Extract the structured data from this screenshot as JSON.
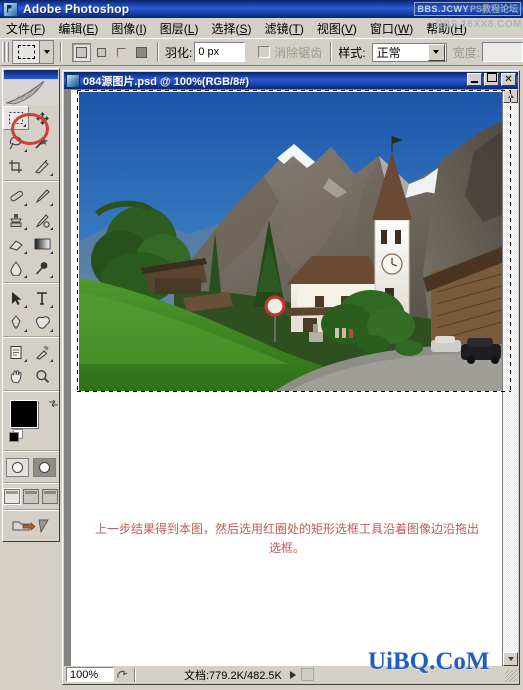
{
  "app": {
    "title": "Adobe Photoshop",
    "logo_icon": "photoshop-logo-icon",
    "watermark_top": "BBS.JCWY",
    "watermark_top2": "PS教程论坛",
    "watermark_menu": "BBS.16XX8.COM"
  },
  "menubar": {
    "items": [
      {
        "label": "文件",
        "mnemonic": "F"
      },
      {
        "label": "编辑",
        "mnemonic": "E"
      },
      {
        "label": "图像",
        "mnemonic": "I"
      },
      {
        "label": "图层",
        "mnemonic": "L"
      },
      {
        "label": "选择",
        "mnemonic": "S"
      },
      {
        "label": "滤镜",
        "mnemonic": "T"
      },
      {
        "label": "视图",
        "mnemonic": "V"
      },
      {
        "label": "窗口",
        "mnemonic": "W"
      },
      {
        "label": "帮助",
        "mnemonic": "H"
      }
    ]
  },
  "options_bar": {
    "tool_icon": "rectangular-marquee-icon",
    "tool_dropdown_icon": "chevron-down-icon",
    "selection_modes": [
      {
        "name": "new-selection",
        "active": true
      },
      {
        "name": "add-to-selection",
        "active": false
      },
      {
        "name": "subtract-from-selection",
        "active": false
      },
      {
        "name": "intersect-with-selection",
        "active": false
      }
    ],
    "feather_label": "羽化:",
    "feather_value": "0 px",
    "antialias_label": "消除锯齿",
    "antialias_checked": false,
    "style_label": "样式:",
    "style_value": "正常",
    "width_label": "宽度:",
    "width_value": ""
  },
  "toolbox": {
    "tools": [
      {
        "name": "rectangular-marquee-tool",
        "icon": "marquee-icon",
        "selected": true,
        "highlighted": true
      },
      {
        "name": "move-tool",
        "icon": "move-arrow-icon",
        "selected": false
      },
      {
        "name": "lasso-tool",
        "icon": "lasso-icon",
        "selected": false
      },
      {
        "name": "magic-wand-tool",
        "icon": "magic-wand-icon",
        "selected": false
      },
      {
        "name": "crop-tool",
        "icon": "crop-icon",
        "selected": false
      },
      {
        "name": "slice-tool",
        "icon": "slice-knife-icon",
        "selected": false
      },
      {
        "name": "healing-brush-tool",
        "icon": "healing-brush-icon",
        "selected": false
      },
      {
        "name": "brush-tool",
        "icon": "paintbrush-icon",
        "selected": false
      },
      {
        "name": "clone-stamp-tool",
        "icon": "clone-stamp-icon",
        "selected": false
      },
      {
        "name": "history-brush-tool",
        "icon": "history-brush-icon",
        "selected": false
      },
      {
        "name": "eraser-tool",
        "icon": "eraser-icon",
        "selected": false
      },
      {
        "name": "gradient-tool",
        "icon": "gradient-icon",
        "selected": false
      },
      {
        "name": "blur-tool",
        "icon": "waterdrop-icon",
        "selected": false
      },
      {
        "name": "dodge-tool",
        "icon": "dodge-icon",
        "selected": false
      },
      {
        "name": "path-selection-tool",
        "icon": "black-arrow-icon",
        "selected": false
      },
      {
        "name": "type-tool",
        "icon": "type-t-icon",
        "selected": false
      },
      {
        "name": "pen-tool",
        "icon": "pen-icon",
        "selected": false
      },
      {
        "name": "custom-shape-tool",
        "icon": "shape-blob-icon",
        "selected": false
      },
      {
        "name": "notes-tool",
        "icon": "notes-page-icon",
        "selected": false
      },
      {
        "name": "eyedropper-tool",
        "icon": "eyedropper-icon",
        "selected": false
      },
      {
        "name": "hand-tool",
        "icon": "hand-icon",
        "selected": false
      },
      {
        "name": "zoom-tool",
        "icon": "magnifier-icon",
        "selected": false
      }
    ],
    "foreground_color": "#000000",
    "background_color": "#ffffff",
    "swap_colors_icon": "swap-arrows-icon",
    "default_colors_icon": "default-colors-icon",
    "quickmask": [
      {
        "name": "standard-mode-button",
        "active": true
      },
      {
        "name": "quick-mask-mode-button",
        "active": false
      }
    ],
    "screen_modes": [
      {
        "name": "standard-screen-mode-button",
        "active": true
      },
      {
        "name": "full-screen-with-menubar-button",
        "active": false
      },
      {
        "name": "full-screen-mode-button",
        "active": false
      }
    ],
    "jump_to_icon": "jump-to-imageready-icon",
    "highlight_color": "#d04036"
  },
  "document": {
    "icon": "document-icon",
    "title": "084源图片.psd @ 100%(RGB/8#)",
    "window_buttons": {
      "minimize": "minimize-button",
      "maximize": "maximize-button",
      "close": "close-button",
      "close_glyph": "✕"
    },
    "caption_text": "上一步结果得到本图，然后选用红圈处的矩形选框工具沿着图像边沿拖出选框。",
    "caption_color": "#c45a5a",
    "selection_active": true,
    "scrollbar": {
      "up_icon": "scroll-up-arrow-icon",
      "down_icon": "scroll-down-arrow-icon"
    }
  },
  "statusbar": {
    "zoom": "100%",
    "grip_icon": "status-grip-icon",
    "doc_info": "文档:779.2K/482.5K",
    "more_icon": "status-more-arrow-icon",
    "resize_grip_icon": "resize-grip-icon"
  },
  "overlay_watermark": {
    "text": "UiBQ.CoM",
    "color": "#1f5fc4"
  },
  "photo": {
    "description": "alpine-village-church-photo",
    "sky_color": "#2d6fbd",
    "grass_color": "#3f8a25",
    "mountain_color": "#6d6a62",
    "church_color": "#f2efe6"
  }
}
